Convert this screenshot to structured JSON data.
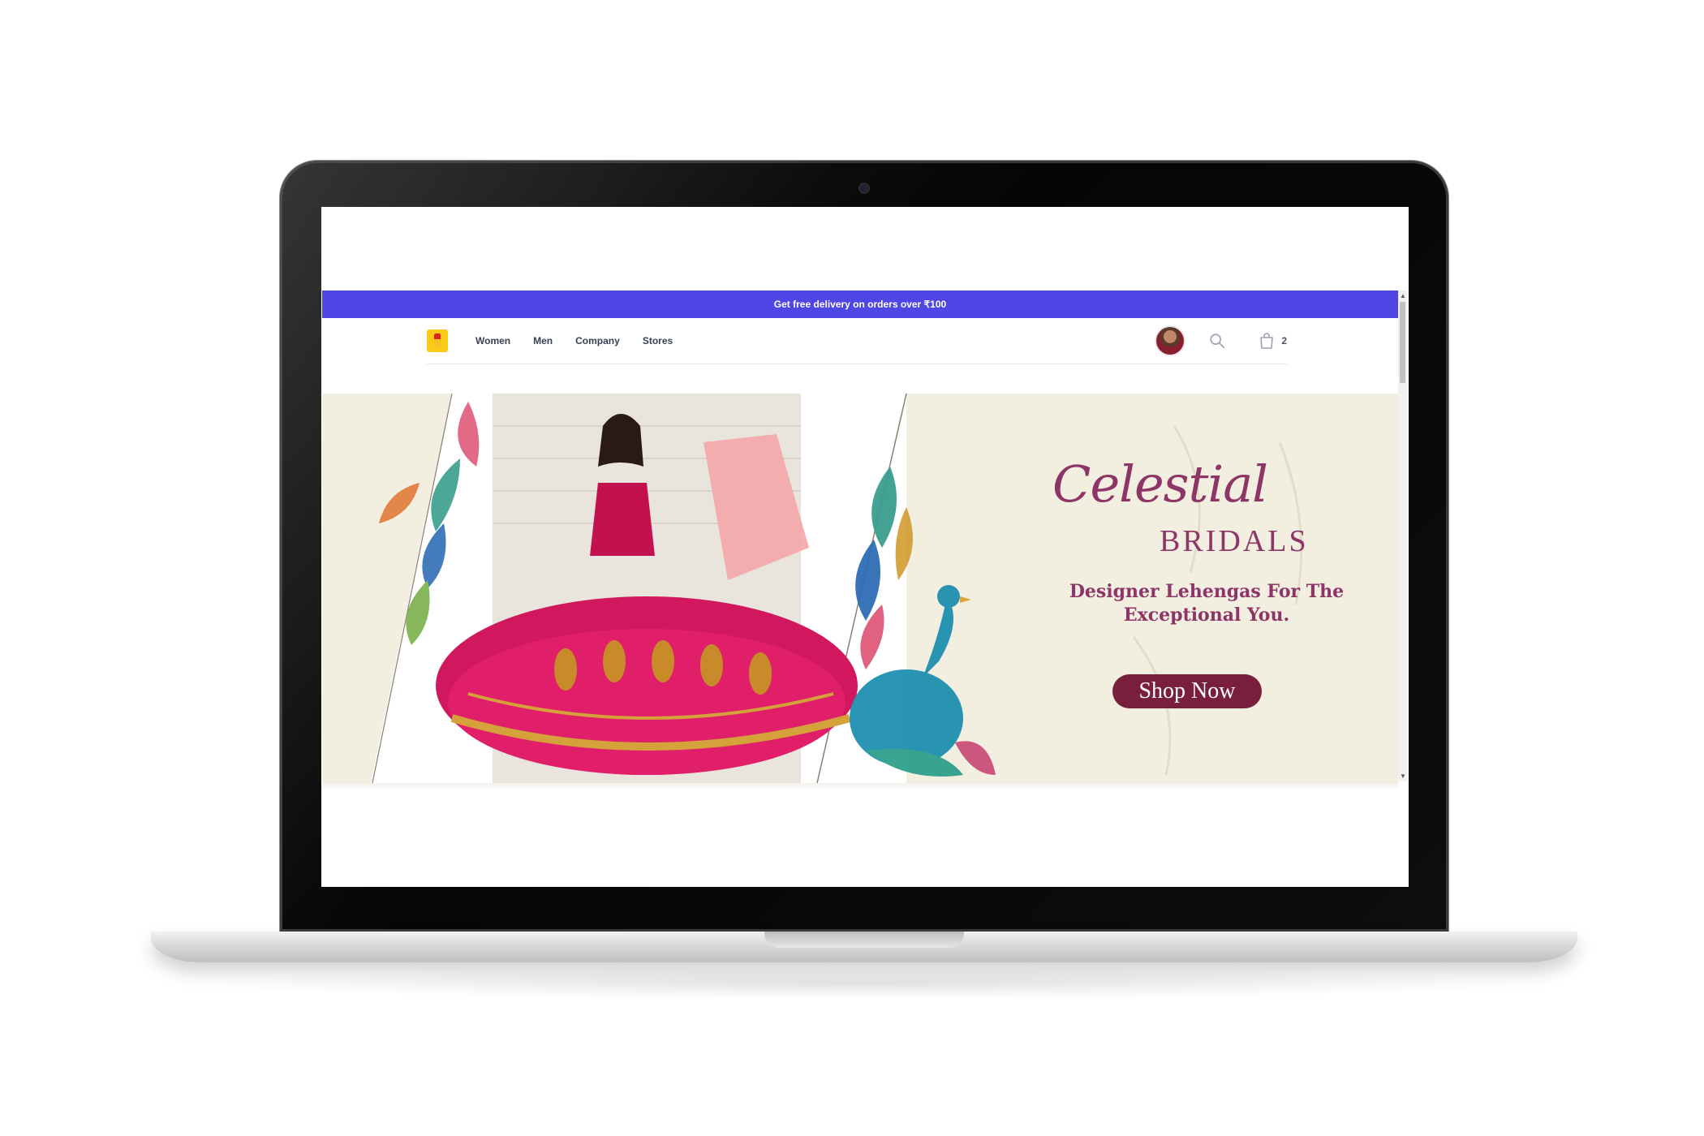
{
  "promo": {
    "text": "Get free delivery on orders over ₹100"
  },
  "nav": {
    "links": [
      "Women",
      "Men",
      "Company",
      "Stores"
    ],
    "cart_count": "2"
  },
  "hero": {
    "title": "Celestial",
    "subtitle": "BRIDALS",
    "tagline_line1": "Designer Lehengas For The",
    "tagline_line2": "Exceptional You.",
    "cta": "Shop Now"
  },
  "colors": {
    "promo_bg": "#4f46e5",
    "hero_bg": "#f2eee0",
    "accent_text": "#8e3567",
    "cta_bg": "#7a1f3b"
  },
  "icons": [
    "search-icon",
    "shopping-bag-icon",
    "avatar",
    "logo"
  ]
}
